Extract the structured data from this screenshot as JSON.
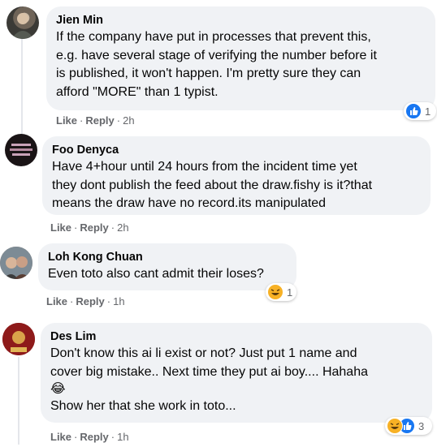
{
  "comments": [
    {
      "author": "Jien Min",
      "text": "If the company have put in processes that prevent this,\ne.g. have several stage of verifying the number before it\nis published, it won't happen. I'm pretty sure they can\nafford \"MORE\" than 1 typist.",
      "like": "Like",
      "reply": "Reply",
      "time": "2h",
      "reactions": [
        "like"
      ],
      "reaction_count": "1"
    },
    {
      "author": "Foo Denyca",
      "text": "Have 4+hour until 24 hours from the incident time yet\nthey dont publish the feed about the draw.fishy is it?that\nmeans the draw have no record.its manipulated",
      "like": "Like",
      "reply": "Reply",
      "time": "2h"
    },
    {
      "author": "Loh Kong Chuan",
      "text": "Even toto also cant admit their loses?",
      "like": "Like",
      "reply": "Reply",
      "time": "1h",
      "reactions": [
        "haha"
      ],
      "reaction_count": "1"
    },
    {
      "author": "Des Lim",
      "text": "Don't know this ai li exist or not? Just put 1 name and\ncover big mistake.. Next time they put ai boy.... Hahaha",
      "emoji": "😂",
      "text2": "Show her that she work in toto...",
      "like": "Like",
      "reply": "Reply",
      "time": "1h",
      "reactions": [
        "haha",
        "like"
      ],
      "reaction_count": "3"
    }
  ],
  "colors": {
    "bubble": "#f0f2f5",
    "secondary_text": "#65676b",
    "like_blue": "#1877f2",
    "haha_yellow": "#f7b125"
  }
}
